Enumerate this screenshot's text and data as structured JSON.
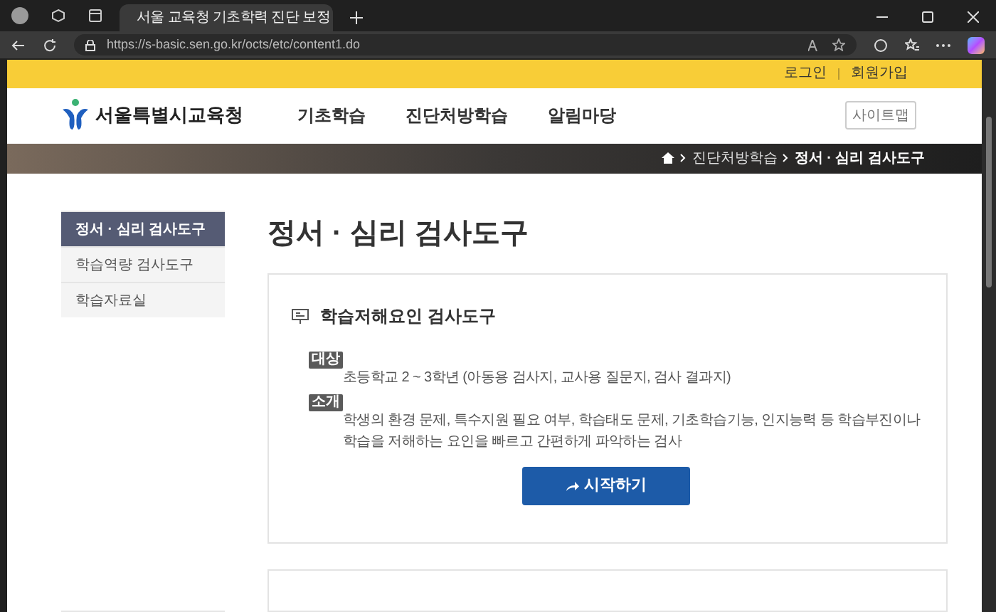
{
  "browser": {
    "tab_title": "서울 교육청 기초학력 진단 보정",
    "url": "https://s-basic.sen.go.kr/octs/etc/content1.do"
  },
  "top_links": [
    "로그인",
    "회원가입"
  ],
  "logo": "서울특별시교육청",
  "nav": [
    "기초학습",
    "진단처방학습",
    "알림마당"
  ],
  "sitemap_button": "사이트맵",
  "breadcrumb": [
    "진단처방학습",
    "정서 · 심리 검사도구"
  ],
  "sidebar": {
    "items": [
      {
        "label": "정서 · 심리 검사도구",
        "selected": true
      },
      {
        "label": "학습역량 검사도구",
        "selected": false
      },
      {
        "label": "학습자료실",
        "selected": false
      }
    ]
  },
  "page_title": "정서 · 심리 검사도구",
  "card": {
    "title": "학습저해요인 검사도구",
    "rows": [
      {
        "tag": "대상",
        "lines": [
          "초등학교 2 ~ 3학년 (아동용 검사지, 교사용 질문지, 검사 결과지)"
        ]
      },
      {
        "tag": "소개",
        "lines": [
          "학생의 환경 문제, 특수지원 필요 여부, 학습태도 문제, 기초학습기능, 인지능력 등 학습부진이나",
          "학습을 저해하는 요인을 빠르고 간편하게 파악하는 검사"
        ]
      }
    ],
    "button": "시작하기"
  }
}
